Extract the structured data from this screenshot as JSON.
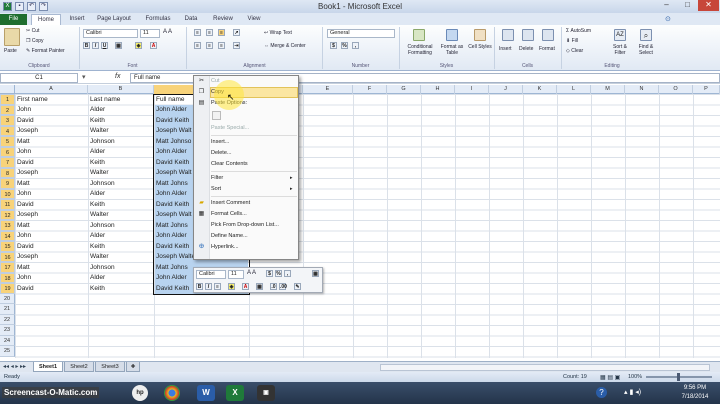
{
  "window": {
    "title": "Book1 - Microsoft Excel"
  },
  "ribbon": {
    "tabs": [
      "File",
      "Home",
      "Insert",
      "Page Layout",
      "Formulas",
      "Data",
      "Review",
      "View"
    ],
    "clipboard": {
      "paste": "Paste",
      "cut": "Cut",
      "copy": "Copy",
      "format_painter": "Format Painter",
      "group": "Clipboard"
    },
    "font": {
      "name": "Calibri",
      "size": "11",
      "bold": "B",
      "italic": "I",
      "underline": "U",
      "group": "Font"
    },
    "alignment": {
      "wrap": "Wrap Text",
      "merge": "Merge & Center",
      "group": "Alignment"
    },
    "number": {
      "format": "General",
      "currency": "$",
      "percent": "%",
      "comma": ",",
      "group": "Number"
    },
    "styles": {
      "cond": "Conditional Formatting",
      "table": "Format as Table",
      "cell": "Cell Styles",
      "group": "Styles"
    },
    "cells": {
      "insert": "Insert",
      "delete": "Delete",
      "format": "Format",
      "group": "Cells"
    },
    "editing": {
      "autosum": "AutoSum",
      "fill": "Fill",
      "clear": "Clear",
      "sort": "Sort & Filter",
      "find": "Find & Select",
      "group": "Editing"
    }
  },
  "formula_bar": {
    "name_box": "C1",
    "fx": "fx",
    "content": "Full name"
  },
  "columns": [
    "A",
    "B",
    "C",
    "D",
    "E",
    "F",
    "G",
    "H",
    "I",
    "J",
    "K",
    "L",
    "M",
    "N",
    "O",
    "P"
  ],
  "rows": [
    "1",
    "2",
    "3",
    "4",
    "5",
    "6",
    "7",
    "8",
    "9",
    "10",
    "11",
    "12",
    "13",
    "14",
    "15",
    "16",
    "17",
    "18",
    "19",
    "20",
    "21",
    "22",
    "23",
    "24",
    "25"
  ],
  "cells": [
    [
      "First name",
      "Last name",
      "Full name"
    ],
    [
      "John",
      "Alder",
      "John Alder"
    ],
    [
      "David",
      "Keith",
      "David Keith"
    ],
    [
      "Joseph",
      "Walter",
      "Joseph Walt"
    ],
    [
      "Matt",
      "Johnson",
      "Matt Johnso"
    ],
    [
      "John",
      "Alder",
      "John Alder"
    ],
    [
      "David",
      "Keith",
      "David Keith"
    ],
    [
      "Joseph",
      "Walter",
      "Joseph Walt"
    ],
    [
      "Matt",
      "Johnson",
      "Matt Johns"
    ],
    [
      "John",
      "Alder",
      "John Alder"
    ],
    [
      "David",
      "Keith",
      "David Keith"
    ],
    [
      "Joseph",
      "Walter",
      "Joseph Walt"
    ],
    [
      "Matt",
      "Johnson",
      "Matt Johns"
    ],
    [
      "John",
      "Alder",
      "John Alder"
    ],
    [
      "David",
      "Keith",
      "David Keith"
    ],
    [
      "Joseph",
      "Walter",
      "Joseph Walter"
    ],
    [
      "Matt",
      "Johnson",
      "Matt Johns"
    ],
    [
      "John",
      "Alder",
      "John Alder"
    ],
    [
      "David",
      "Keith",
      "David Keith"
    ]
  ],
  "context_menu": {
    "cut": "Cut",
    "copy": "Copy",
    "paste_options": "Paste Options:",
    "paste_special": "Paste Special...",
    "insert": "Insert...",
    "delete": "Delete...",
    "clear": "Clear Contents",
    "filter": "Filter",
    "sort": "Sort",
    "comment": "Insert Comment",
    "format_cells": "Format Cells...",
    "pick": "Pick From Drop-down List...",
    "define": "Define Name...",
    "hyperlink": "Hyperlink..."
  },
  "mini_toolbar": {
    "font": "Calibri",
    "size": "11",
    "bold": "B",
    "italic": "I",
    "currency": "$",
    "percent": "%"
  },
  "sheets": [
    "Sheet1",
    "Sheet2",
    "Sheet3"
  ],
  "status": {
    "ready": "Ready",
    "count": "Count: 19",
    "zoom": "100%"
  },
  "taskbar": {
    "watermark": "Screencast-O-Matic.com",
    "time": "9:56 PM",
    "date": "7/18/2014"
  },
  "colors": {
    "file_tab": "#1f6e2f",
    "selection": "#b8d3ef",
    "highlight": "#f8d37a"
  }
}
